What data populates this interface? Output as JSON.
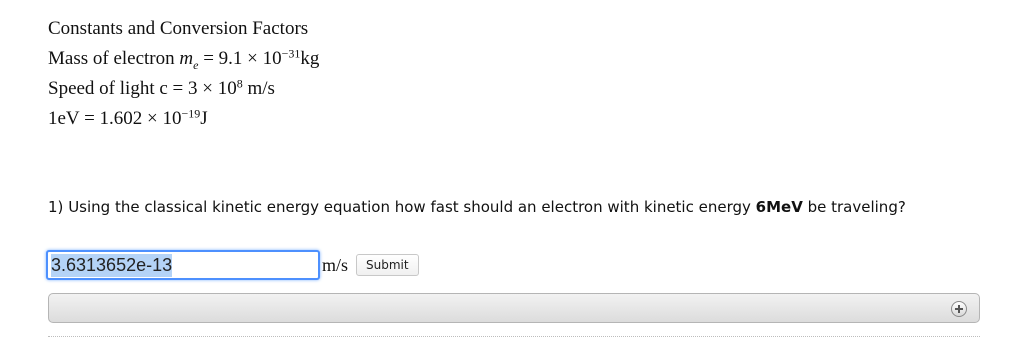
{
  "constants": {
    "heading": "Constants and Conversion Factors",
    "electron_mass": {
      "label": "Mass of electron",
      "symbol": "m",
      "symbol_sub": "e",
      "equals": "=",
      "mantissa": "9.1 × 10",
      "exponent": "−31",
      "unit": "kg"
    },
    "speed_of_light": {
      "label": "Speed of light c",
      "equals": "=",
      "mantissa": "3 × 10",
      "exponent": "8",
      "unit": "m/s"
    },
    "electron_volt": {
      "label": "1eV",
      "equals": "=",
      "mantissa": "1.602 × 10",
      "exponent": "−19",
      "unit": "J"
    }
  },
  "question": {
    "number": "1)",
    "text_before": "Using the classical kinetic energy equation how fast should an electron with kinetic energy",
    "energy": "6MeV",
    "text_after": "be traveling?"
  },
  "answer": {
    "value": "3.6313652e-13",
    "unit": "m/s",
    "submit_label": "Submit"
  },
  "feedback": {
    "icon": "plus-circle-icon"
  },
  "colors": {
    "input_focus_border": "#4d90fe",
    "selection": "#b4d3f7"
  }
}
